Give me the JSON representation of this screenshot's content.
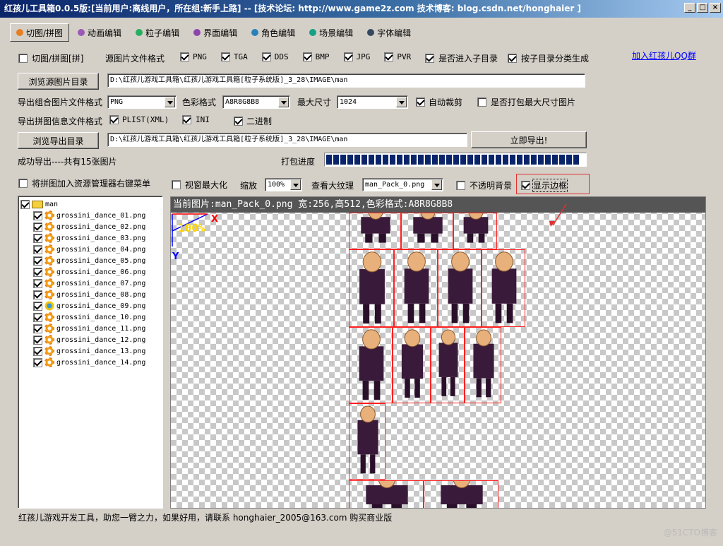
{
  "window": {
    "title": "红孩儿工具箱0.0.5版:[当前用户:离线用户，所在组:新手上路]  --  [技术论坛: http://www.game2z.com 技术博客: blog.csdn.net/honghaier ]",
    "min": "_",
    "max": "□",
    "close": "×"
  },
  "tabs": [
    {
      "label": "切图/拼图",
      "color": "#e67e22"
    },
    {
      "label": "动画编辑",
      "color": "#9b59b6"
    },
    {
      "label": "粒子编辑",
      "color": "#27ae60"
    },
    {
      "label": "界面编辑",
      "color": "#8e44ad"
    },
    {
      "label": "角色编辑",
      "color": "#2980b9"
    },
    {
      "label": "场景编辑",
      "color": "#16a085"
    },
    {
      "label": "字体编辑",
      "color": "#34495e"
    }
  ],
  "options": {
    "split_merge": {
      "label": "切图/拼图[拼]",
      "checked": false
    },
    "source_format_label": "源图片文件格式",
    "formats": [
      {
        "label": "PNG",
        "checked": true
      },
      {
        "label": "TGA",
        "checked": true
      },
      {
        "label": "DDS",
        "checked": true
      },
      {
        "label": "BMP",
        "checked": true
      },
      {
        "label": "JPG",
        "checked": true
      },
      {
        "label": "PVR",
        "checked": true
      }
    ],
    "enter_subdir": {
      "label": "是否进入子目录",
      "checked": true
    },
    "by_subdir": {
      "label": "按子目录分类生成",
      "checked": true
    },
    "qq_link": "加入红孩儿QQ群"
  },
  "source": {
    "button": "浏览源图片目录",
    "path": "D:\\红孩儿游戏工具箱\\红孩儿游戏工具箱[粒子系统版]_3_28\\IMAGE\\man"
  },
  "export": {
    "format_label": "导出组合图片文件格式",
    "format_value": "PNG",
    "color_label": "色彩格式",
    "color_value": "A8R8G8B8",
    "maxsize_label": "最大尺寸",
    "maxsize_value": "1024",
    "auto_crop": {
      "label": "自动裁剪",
      "checked": true
    },
    "pack_max": {
      "label": "是否打包最大尺寸图片",
      "checked": false
    },
    "info_label": "导出拼图信息文件格式",
    "plist": {
      "label": "PLIST(XML)",
      "checked": true
    },
    "ini": {
      "label": "INI",
      "checked": true
    },
    "binary": {
      "label": "二进制",
      "checked": true
    },
    "browse_button": "浏览导出目录",
    "path": "D:\\红孩儿游戏工具箱\\红孩儿游戏工具箱[粒子系统版]_3_28\\IMAGE\\man",
    "export_button": "立即导出!",
    "success_text": "成功导出----共有15张图片",
    "progress_label": "打包进度",
    "progress_pct": 100
  },
  "view": {
    "context_menu": {
      "label": "将拼图加入资源管理器右键菜单",
      "checked": false
    },
    "maximize": {
      "label": "视窗最大化",
      "checked": false
    },
    "zoom_label": "缩放",
    "zoom_value": "100%",
    "texture_label": "查看大纹理",
    "texture_value": "man_Pack_0.png",
    "opaque_bg": {
      "label": "不透明背景",
      "checked": false
    },
    "show_border": {
      "label": "显示边框",
      "checked": true
    }
  },
  "tree": {
    "root": "man",
    "items": [
      "grossini_dance_01.png",
      "grossini_dance_02.png",
      "grossini_dance_03.png",
      "grossini_dance_04.png",
      "grossini_dance_05.png",
      "grossini_dance_06.png",
      "grossini_dance_07.png",
      "grossini_dance_08.png",
      "grossini_dance_09.png",
      "grossini_dance_10.png",
      "grossini_dance_11.png",
      "grossini_dance_12.png",
      "grossini_dance_13.png",
      "grossini_dance_14.png"
    ]
  },
  "canvas": {
    "header": "当前图片:man_Pack_0.png 宽:256,高512,色彩格式:A8R8G8B8",
    "zoom_overlay": "100%",
    "axis_x": "X",
    "axis_y": "Y"
  },
  "status": "红孩儿游戏开发工具，助您一臂之力，如果好用，请联系 honghaier_2005@163.com 购买商业版",
  "watermark": "@51CTO博客"
}
